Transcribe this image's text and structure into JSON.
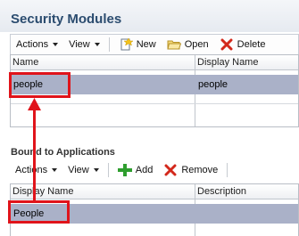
{
  "header": {
    "title": "Security Modules"
  },
  "top_toolbar": {
    "actions_label": "Actions",
    "view_label": "View",
    "new_label": "New",
    "open_label": "Open",
    "delete_label": "Delete"
  },
  "top_table": {
    "columns": [
      "Name",
      "Display Name"
    ],
    "rows": [
      {
        "name": "people",
        "display_name": "people"
      }
    ]
  },
  "bound": {
    "title": "Bound to Applications",
    "toolbar": {
      "actions_label": "Actions",
      "view_label": "View",
      "add_label": "Add",
      "remove_label": "Remove"
    },
    "columns": [
      "Display Name",
      "Description"
    ],
    "rows": [
      {
        "display_name": "People",
        "description": ""
      }
    ]
  },
  "colors": {
    "title": "#2b4c6f",
    "selected_row": "#aab1c8",
    "highlight": "#e0141b",
    "add_icon": "#2e9e2e",
    "remove_icon": "#d3281b"
  }
}
